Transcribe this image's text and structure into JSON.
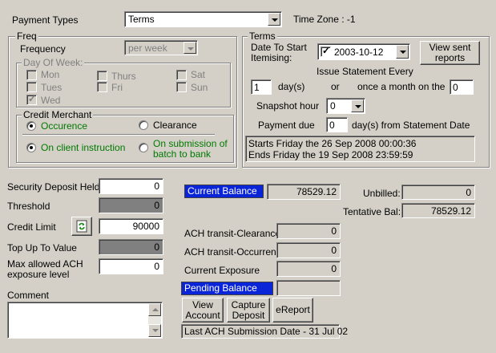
{
  "top": {
    "payment_types_label": "Payment Types",
    "payment_types_value": "Terms",
    "time_zone": "Time Zone : -1"
  },
  "freq": {
    "title": "Freq",
    "frequency_label": "Frequency",
    "frequency_value": "per week",
    "dow_title": "Day Of Week:",
    "days": {
      "mon": "Mon",
      "tues": "Tues",
      "wed": "Wed",
      "thurs": "Thurs",
      "fri": "Fri",
      "sat": "Sat",
      "sun": "Sun"
    }
  },
  "credit_merchant": {
    "title": "Credit Merchant",
    "occurence": "Occurence",
    "clearance": "Clearance",
    "on_client_instruction": "On client instruction",
    "on_submission_line1": "On submission of",
    "on_submission_line2": "batch to bank"
  },
  "terms": {
    "title": "Terms",
    "date_label_line1": "Date To Start",
    "date_label_line2": "Itemising:",
    "date_value": "2003-10-12",
    "view_sent_line1": "View sent",
    "view_sent_line2": "reports",
    "issue_label": "Issue Statement Every",
    "days_value": "1",
    "days_label": "day(s)",
    "or_label": "or",
    "once_label": "once a month on the",
    "once_value": "0",
    "snapshot_label": "Snapshot hour",
    "snapshot_value": "0",
    "payment_due_label": "Payment due",
    "payment_due_value": "0",
    "payment_due_suffix": "day(s) from Statement Date",
    "info_line1": "Starts Friday the 26 Sep 2008 00:00:36",
    "info_line2": "Ends Friday the 19 Sep 2008 23:59:59"
  },
  "left_fields": {
    "security_deposit_label": "Security Deposit Held",
    "security_deposit_value": "0",
    "threshold_label": "Threshold",
    "threshold_value": "0",
    "credit_limit_label": "Credit Limit",
    "credit_limit_value": "90000",
    "top_up_label": "Top Up To Value",
    "top_up_value": "0",
    "max_ach_label_line1": "Max allowed ACH",
    "max_ach_label_line2": "exposure level",
    "max_ach_value": "0",
    "comment_label": "Comment",
    "comment_value": ""
  },
  "balances": {
    "current_balance_label": "Current Balance",
    "current_balance_value": "78529.12",
    "unbilled_label": "Unbilled:",
    "unbilled_value": "0",
    "tentative_label": "Tentative Bal:",
    "tentative_value": "78529.12",
    "ach_clearance_label": "ACH transit-Clearance",
    "ach_clearance_value": "0",
    "ach_occurrence_label": "ACH transit-Occurrence",
    "ach_occurrence_value": "0",
    "current_exposure_label": "Current Exposure",
    "current_exposure_value": "0",
    "pending_balance_label": "Pending Balance",
    "pending_balance_value": ""
  },
  "buttons": {
    "view_account_line1": "View",
    "view_account_line2": "Account",
    "capture_deposit_line1": "Capture",
    "capture_deposit_line2": "Deposit",
    "ereport": "eReport"
  },
  "status": {
    "last_ach": "Last ACH Submission Date - 31 Jul 02"
  },
  "colors": {
    "background": "#d4d0c8",
    "highlight_blue": "#0a24d8",
    "green_text": "#007a00"
  }
}
